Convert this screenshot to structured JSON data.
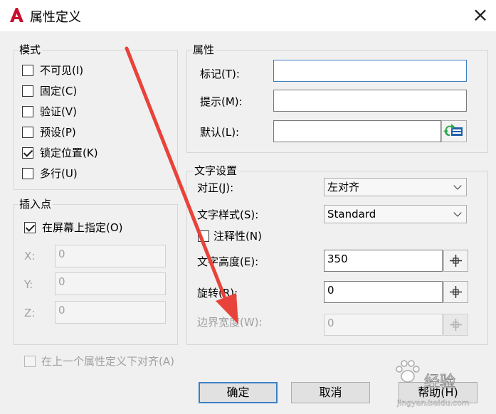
{
  "window": {
    "title": "属性定义",
    "close_symbol": "×"
  },
  "mode": {
    "title": "模式",
    "items": [
      {
        "label": "不可见(I)",
        "checked": false
      },
      {
        "label": "固定(C)",
        "checked": false
      },
      {
        "label": "验证(V)",
        "checked": false
      },
      {
        "label": "预设(P)",
        "checked": false
      },
      {
        "label": "锁定位置(K)",
        "checked": true
      },
      {
        "label": "多行(U)",
        "checked": false
      }
    ]
  },
  "insert_point": {
    "title": "插入点",
    "on_screen_label": "在屏幕上指定(O)",
    "on_screen_checked": true,
    "x_label": "X:",
    "x_value": "0",
    "y_label": "Y:",
    "y_value": "0",
    "z_label": "Z:",
    "z_value": "0"
  },
  "attribute": {
    "title": "属性",
    "tag_label": "标记(T):",
    "tag_value": "",
    "prompt_label": "提示(M):",
    "prompt_value": "",
    "default_label": "默认(L):",
    "default_value": ""
  },
  "text_settings": {
    "title": "文字设置",
    "justify_label": "对正(J):",
    "justify_value": "左对齐",
    "style_label": "文字样式(S):",
    "style_value": "Standard",
    "annotative_label": "注释性(N)",
    "annotative_checked": false,
    "height_label": "文字高度(E):",
    "height_value": "350",
    "rotation_label": "旋转(R):",
    "rotation_value": "0",
    "boundary_label": "边界宽度(W):",
    "boundary_value": "0"
  },
  "align_below": {
    "label": "在上一个属性定义下对齐(A)",
    "checked": false
  },
  "buttons": {
    "ok": "确定",
    "cancel": "取消",
    "help": "帮助(H)"
  },
  "watermark": {
    "text": "经验",
    "url": "jingyan.baidu.com"
  },
  "colors": {
    "accent": "#3c7fc4",
    "annotation_arrow": "#e8433a",
    "logo": "#c8102e"
  }
}
